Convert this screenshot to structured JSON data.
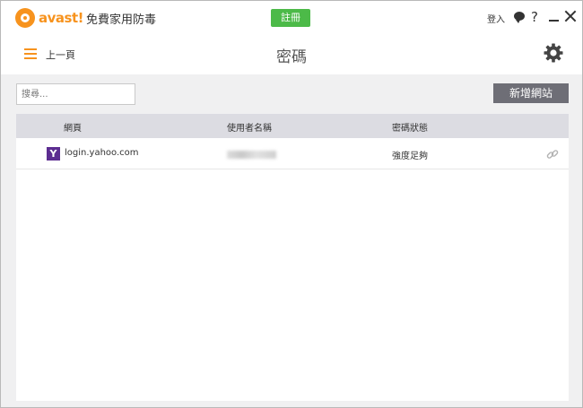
{
  "header": {
    "logo_text": "avast!",
    "app_title": "免費家用防毒",
    "register_label": "註冊",
    "login_label": "登入",
    "help_label": "?"
  },
  "nav": {
    "back_label": "上一頁",
    "page_title": "密碼"
  },
  "toolbar": {
    "search_placeholder": "搜尋...",
    "add_site_label": "新增網站"
  },
  "table": {
    "columns": [
      "網頁",
      "使用者名稱",
      "密碼狀態"
    ],
    "rows": [
      {
        "site_icon": "Y",
        "site": "login.yahoo.com",
        "username": "",
        "status": "強度足夠"
      }
    ]
  },
  "colors": {
    "brand_orange": "#f7931e",
    "register_green": "#4cba48",
    "add_button_gray": "#6e6e76",
    "yahoo_purple": "#5c2d91"
  },
  "icons": [
    "avast-logo-icon",
    "chat-icon",
    "help-icon",
    "minimize-icon",
    "close-icon",
    "menu-icon",
    "gear-icon",
    "yahoo-icon",
    "link-icon"
  ]
}
